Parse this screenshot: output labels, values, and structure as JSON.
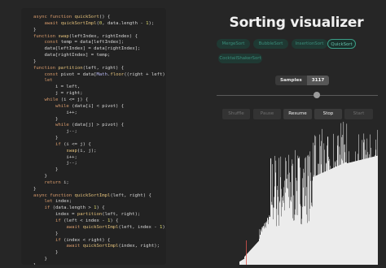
{
  "code": {
    "lines": [
      [
        {
          "t": "async ",
          "c": "kw"
        },
        {
          "t": "function ",
          "c": "kw"
        },
        {
          "t": "quickSort",
          "c": "fn"
        },
        {
          "t": "() {"
        }
      ],
      [
        {
          "t": "    "
        },
        {
          "t": "await ",
          "c": "kw"
        },
        {
          "t": "quickSortImpl",
          "c": "fn"
        },
        {
          "t": "("
        },
        {
          "t": "0",
          "c": "num"
        },
        {
          "t": ", data.length - "
        },
        {
          "t": "1",
          "c": "num"
        },
        {
          "t": ");"
        }
      ],
      [
        {
          "t": "}"
        }
      ],
      [
        {
          "t": "function ",
          "c": "kw"
        },
        {
          "t": "swap",
          "c": "fn"
        },
        {
          "t": "(leftIndex, rightIndex) {"
        }
      ],
      [
        {
          "t": "    "
        },
        {
          "t": "const ",
          "c": "kw"
        },
        {
          "t": "temp = data[leftIndex];"
        }
      ],
      [
        {
          "t": "    data[leftIndex] = data[rightIndex];"
        }
      ],
      [
        {
          "t": "    data[rightIndex] = temp;"
        }
      ],
      [
        {
          "t": "}"
        }
      ],
      [
        {
          "t": "function ",
          "c": "kw"
        },
        {
          "t": "partition",
          "c": "fn"
        },
        {
          "t": "(left, right) {"
        }
      ],
      [
        {
          "t": "    "
        },
        {
          "t": "const ",
          "c": "kw"
        },
        {
          "t": "pivot = data["
        },
        {
          "t": "Math",
          "c": "var"
        },
        {
          "t": "."
        },
        {
          "t": "floor",
          "c": "fn"
        },
        {
          "t": "((right + left) / "
        },
        {
          "t": "2",
          "c": "num"
        },
        {
          "t": ")];"
        }
      ],
      [
        {
          "t": "    "
        },
        {
          "t": "let",
          "c": "kw"
        }
      ],
      [
        {
          "t": "        i = left,"
        }
      ],
      [
        {
          "t": "        j = right;"
        }
      ],
      [
        {
          "t": "    "
        },
        {
          "t": "while ",
          "c": "kw"
        },
        {
          "t": "(i <= j) {"
        }
      ],
      [
        {
          "t": "        "
        },
        {
          "t": "while ",
          "c": "kw"
        },
        {
          "t": "(data[i] < pivot) {"
        }
      ],
      [
        {
          "t": "            i++;"
        }
      ],
      [
        {
          "t": "        }"
        }
      ],
      [
        {
          "t": "        "
        },
        {
          "t": "while ",
          "c": "kw"
        },
        {
          "t": "(data[j] > pivot) {"
        }
      ],
      [
        {
          "t": "            j--;"
        }
      ],
      [
        {
          "t": "        }"
        }
      ],
      [
        {
          "t": "        "
        },
        {
          "t": "if ",
          "c": "kw"
        },
        {
          "t": "(i <= j) {"
        }
      ],
      [
        {
          "t": "            "
        },
        {
          "t": "swap",
          "c": "fn"
        },
        {
          "t": "(i, j);"
        }
      ],
      [
        {
          "t": "            i++;"
        }
      ],
      [
        {
          "t": "            j--;"
        }
      ],
      [
        {
          "t": "        }"
        }
      ],
      [
        {
          "t": "    }"
        }
      ],
      [
        {
          "t": "    "
        },
        {
          "t": "return ",
          "c": "kw"
        },
        {
          "t": "i;"
        }
      ],
      [
        {
          "t": "}"
        }
      ],
      [
        {
          "t": "async ",
          "c": "kw"
        },
        {
          "t": "function ",
          "c": "kw"
        },
        {
          "t": "quickSortImpl",
          "c": "fn"
        },
        {
          "t": "(left, right) {"
        }
      ],
      [
        {
          "t": "    "
        },
        {
          "t": "let ",
          "c": "kw"
        },
        {
          "t": "index;"
        }
      ],
      [
        {
          "t": "    "
        },
        {
          "t": "if ",
          "c": "kw"
        },
        {
          "t": "(data.length > "
        },
        {
          "t": "1",
          "c": "num"
        },
        {
          "t": ") {"
        }
      ],
      [
        {
          "t": "        index = "
        },
        {
          "t": "partition",
          "c": "fn"
        },
        {
          "t": "(left, right);"
        }
      ],
      [
        {
          "t": "        "
        },
        {
          "t": "if ",
          "c": "kw"
        },
        {
          "t": "(left < index - "
        },
        {
          "t": "1",
          "c": "num"
        },
        {
          "t": ") {"
        }
      ],
      [
        {
          "t": "            "
        },
        {
          "t": "await ",
          "c": "kw"
        },
        {
          "t": "quickSortImpl",
          "c": "fn"
        },
        {
          "t": "(left, index - "
        },
        {
          "t": "1",
          "c": "num"
        },
        {
          "t": ");"
        }
      ],
      [
        {
          "t": "        }"
        }
      ],
      [
        {
          "t": "        "
        },
        {
          "t": "if ",
          "c": "kw"
        },
        {
          "t": "(index < right) {"
        }
      ],
      [
        {
          "t": "            "
        },
        {
          "t": "await ",
          "c": "kw"
        },
        {
          "t": "quickSortImpl",
          "c": "fn"
        },
        {
          "t": "(index, right);"
        }
      ],
      [
        {
          "t": "        }"
        }
      ],
      [
        {
          "t": "    }"
        }
      ],
      [
        {
          "t": "}"
        }
      ]
    ]
  },
  "header": {
    "title": "Sorting visualizer"
  },
  "algorithms": [
    {
      "label": "MergeSort",
      "active": false
    },
    {
      "label": "BubbleSort",
      "active": false
    },
    {
      "label": "InsertionSort",
      "active": false
    },
    {
      "label": "QuickSort",
      "active": true
    },
    {
      "label": "CocktailShakerSort",
      "active": false
    }
  ],
  "samples": {
    "label": "Samples",
    "value": "3117",
    "slider_fraction": 0.62
  },
  "controls": [
    {
      "label": "Shuffle",
      "enabled": false
    },
    {
      "label": "Pause",
      "enabled": false
    },
    {
      "label": "Resume",
      "enabled": true
    },
    {
      "label": "Stop",
      "enabled": true
    },
    {
      "label": "Start",
      "enabled": false
    }
  ],
  "colors": {
    "accent": "#3b9c86",
    "bar": "#ececec",
    "highlight": "#d9534f"
  }
}
